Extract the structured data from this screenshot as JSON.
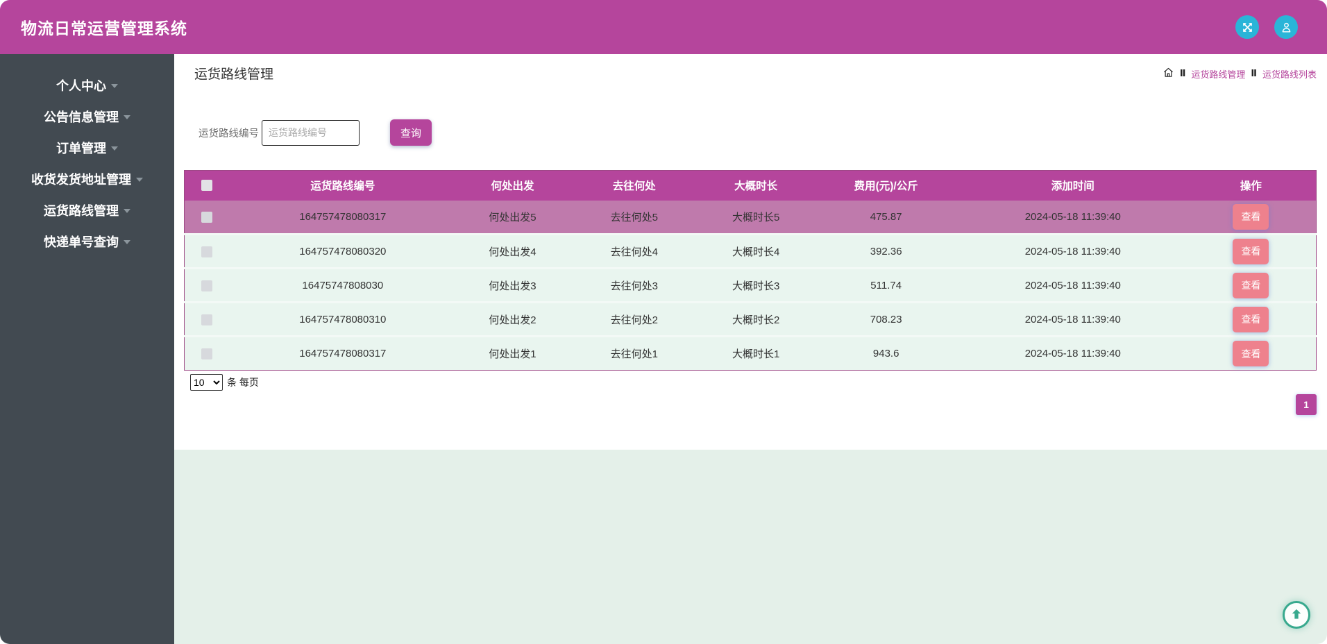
{
  "header": {
    "title": "物流日常运营管理系统",
    "actions": [
      {
        "icon": "fullscreen-icon"
      },
      {
        "icon": "user-icon"
      }
    ]
  },
  "sidebar": {
    "items": [
      "个人中心",
      "公告信息管理",
      "订单管理",
      "收货发货地址管理",
      "运货路线管理",
      "快递单号查询"
    ]
  },
  "breadcrumb": {
    "home_icon": "home-icon",
    "separator": "Ⅱ",
    "links": [
      "运货路线管理",
      "运货路线列表"
    ]
  },
  "main": {
    "page_title": "运货路线管理",
    "search": {
      "label": "运货路线编号",
      "placeholder": "运货路线编号",
      "button": "查询"
    },
    "table": {
      "columns": [
        "运货路线编号",
        "何处出发",
        "去往何处",
        "大概时长",
        "费用(元)/公斤",
        "添加时间",
        "操作"
      ],
      "action_label": "查看",
      "rows": [
        {
          "id": "164757478080317",
          "from": "何处出发5",
          "to": "去往何处5",
          "duration": "大概时长5",
          "fee": "475.87",
          "time": "2024-05-18 11:39:40",
          "highlighted": true
        },
        {
          "id": "164757478080320",
          "from": "何处出发4",
          "to": "去往何处4",
          "duration": "大概时长4",
          "fee": "392.36",
          "time": "2024-05-18 11:39:40",
          "highlighted": false
        },
        {
          "id": "16475747808030",
          "from": "何处出发3",
          "to": "去往何处3",
          "duration": "大概时长3",
          "fee": "511.74",
          "time": "2024-05-18 11:39:40",
          "highlighted": false
        },
        {
          "id": "164757478080310",
          "from": "何处出发2",
          "to": "去往何处2",
          "duration": "大概时长2",
          "fee": "708.23",
          "time": "2024-05-18 11:39:40",
          "highlighted": false
        },
        {
          "id": "164757478080317",
          "from": "何处出发1",
          "to": "去往何处1",
          "duration": "大概时长1",
          "fee": "943.6",
          "time": "2024-05-18 11:39:40",
          "highlighted": false
        }
      ]
    },
    "per_page": {
      "selected": "10",
      "suffix": "条 每页"
    },
    "pagination": {
      "current": "1"
    },
    "back_to_top_icon": "arrow-up-icon"
  },
  "colors": {
    "accent_magenta": "#b5459c",
    "row_highlight": "#bf7aac",
    "action_pink": "#ee818d",
    "icon_cyan": "#2ab5d8",
    "back_top_teal": "#38a98e",
    "sidebar_dark": "#424a51",
    "mint_background": "#e4f0e9",
    "row_mint": "#e9f5ef"
  }
}
